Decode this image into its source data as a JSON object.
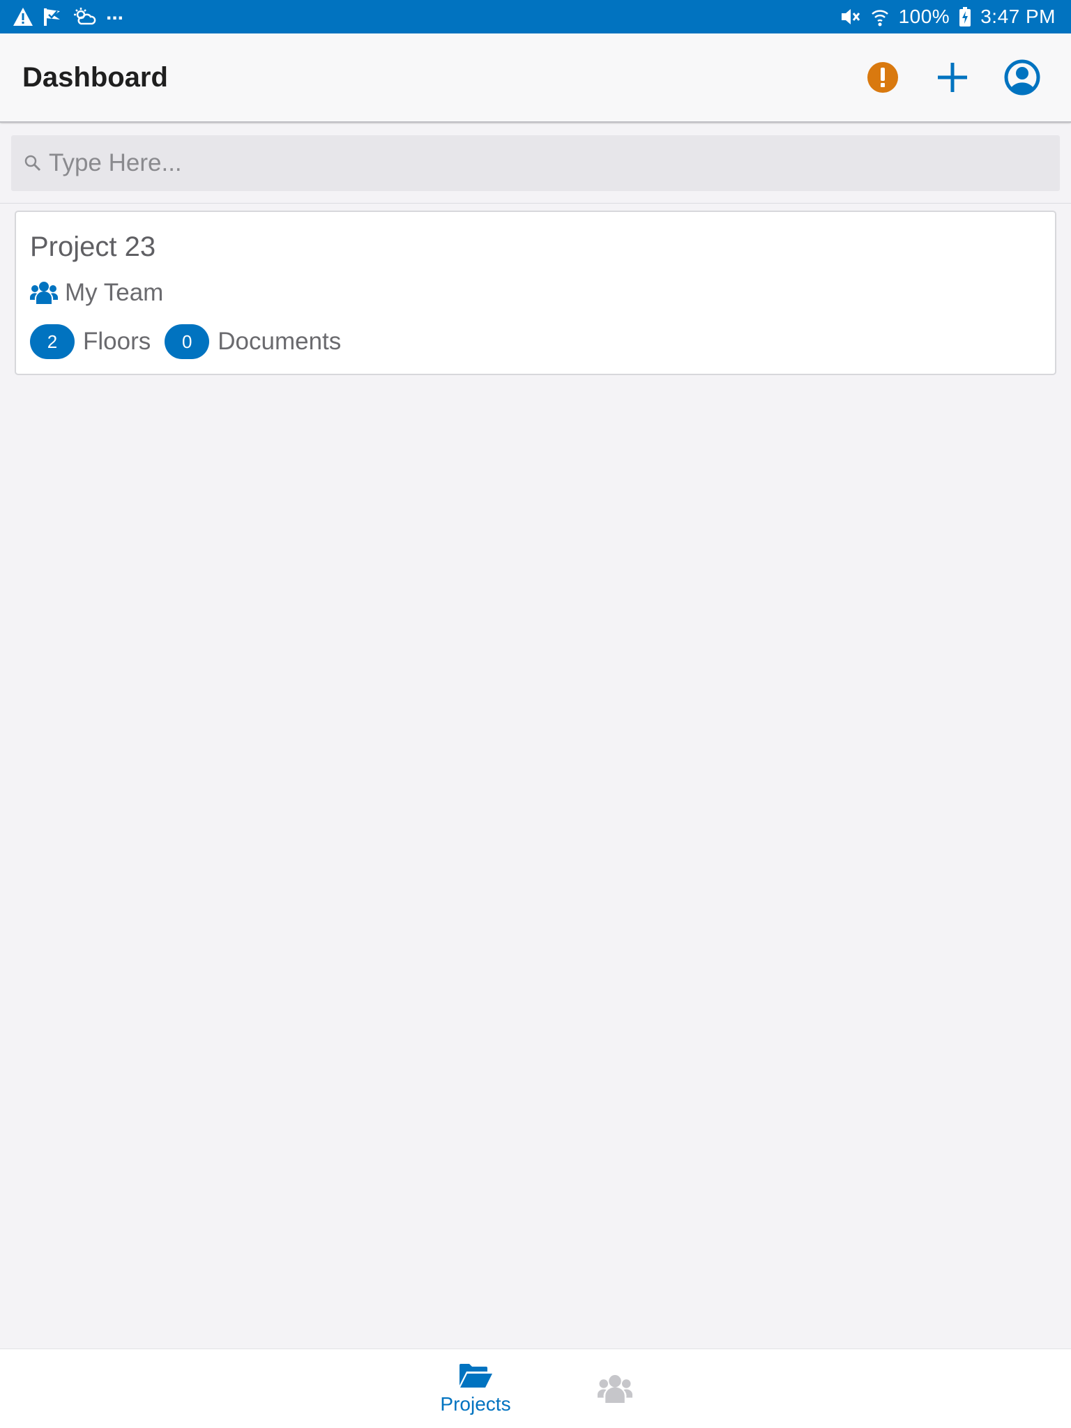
{
  "statusbar": {
    "left_icons": [
      "warning-icon",
      "check-flag-icon",
      "weather-icon"
    ],
    "overflow": "...",
    "battery": "100%",
    "time": "3:47 PM",
    "right_icons": [
      "mute-icon",
      "wifi-icon",
      "battery-charging-icon"
    ]
  },
  "appbar": {
    "title": "Dashboard",
    "actions": [
      "alert-icon",
      "add-icon",
      "account-icon"
    ]
  },
  "search": {
    "placeholder": "Type Here...",
    "value": ""
  },
  "projects": [
    {
      "name": "Project 23",
      "team": "My Team",
      "floors_count": "2",
      "floors_label": "Floors",
      "documents_count": "0",
      "documents_label": "Documents"
    }
  ],
  "tabs": {
    "projects_label": "Projects",
    "active": "projects"
  },
  "colors": {
    "brand": "#0173c0",
    "alert": "#d9790f",
    "inactive_tab": "#c6c6ca",
    "background": "#f4f3f6"
  }
}
